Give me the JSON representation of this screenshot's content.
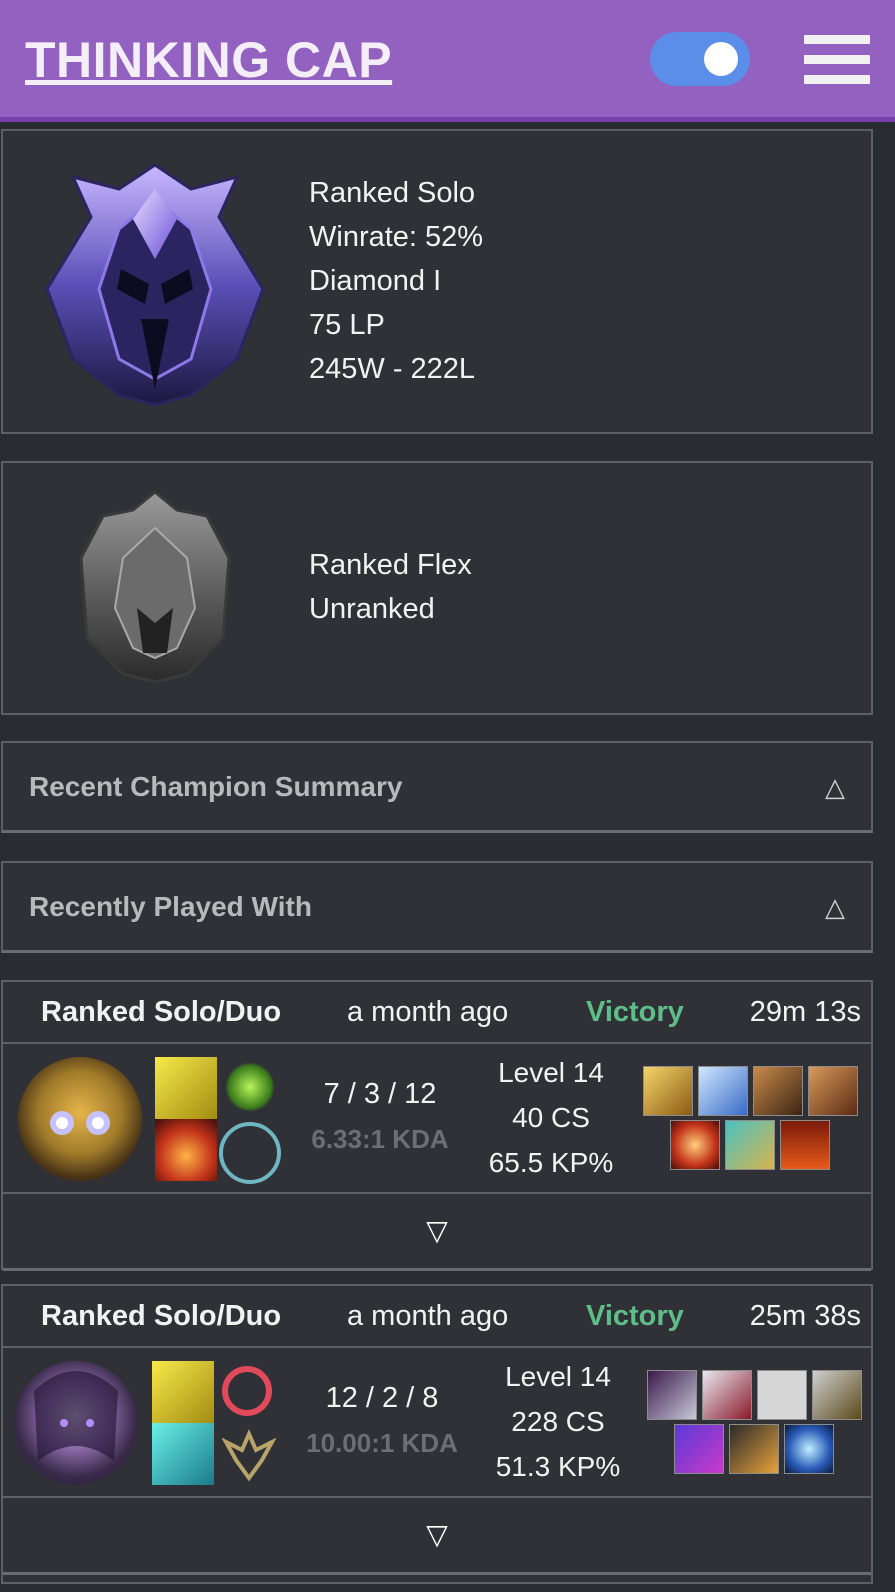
{
  "header": {
    "brand": "THINKING CAP"
  },
  "ranked_solo": {
    "lines": [
      "Ranked Solo",
      "Winrate: 52%",
      "Diamond I",
      "75 LP",
      "245W - 222L"
    ]
  },
  "ranked_flex": {
    "lines": [
      "Ranked Flex",
      "Unranked"
    ]
  },
  "sections": {
    "champion_summary": "Recent Champion Summary",
    "played_with": "Recently Played With",
    "collapse_arrow": "△",
    "expand_arrow": "▽"
  },
  "matches": [
    {
      "queue": "Ranked Solo/Duo",
      "time_ago": "a month ago",
      "result": "Victory",
      "duration": "29m 13s",
      "kda": "7 / 3 / 12",
      "kda_ratio": "6.33:1 KDA",
      "level": "Level 14",
      "cs": "40 CS",
      "kp": "65.5 KP%"
    },
    {
      "queue": "Ranked Solo/Duo",
      "time_ago": "a month ago",
      "result": "Victory",
      "duration": "25m 38s",
      "kda": "12 / 2 / 8",
      "kda_ratio": "10.00:1 KDA",
      "level": "Level 14",
      "cs": "228 CS",
      "kp": "51.3 KP%"
    }
  ],
  "colors": {
    "header": "#9361bf",
    "victory": "#5fbd88",
    "toggle": "#5a8ee8",
    "panel": "#2f3137"
  }
}
